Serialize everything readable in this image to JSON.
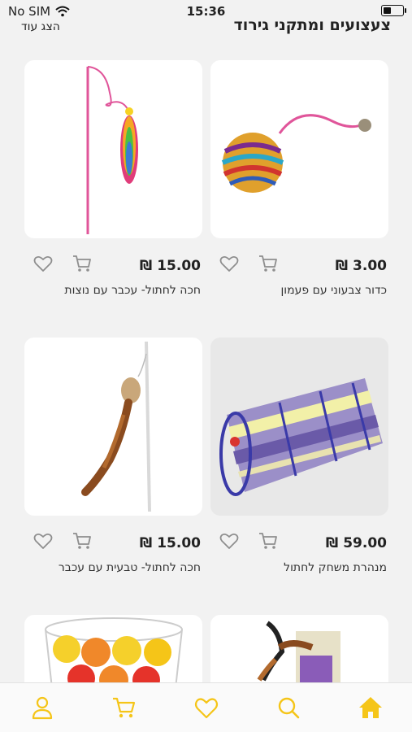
{
  "status": {
    "carrier": "No SIM",
    "time": "15:36"
  },
  "header": {
    "title": "צעצועים ומתקני גירוד",
    "show_more": "הצג עוד"
  },
  "products": [
    {
      "name": "כדור צבעוני עם פעמון",
      "price": "3.00 ₪",
      "image_icon": "ball-with-bell-toy"
    },
    {
      "name": "חכה לחתול- עכבר עם נוצות",
      "price": "15.00 ₪",
      "image_icon": "feather-wand-toy"
    },
    {
      "name": "מנהרת משחק לחתול",
      "price": "59.00 ₪",
      "image_icon": "cat-tunnel"
    },
    {
      "name": "חכה לחתול- טבעית עם עכבר",
      "price": "15.00 ₪",
      "image_icon": "natural-wand-toy"
    },
    {
      "name": "",
      "price": "",
      "image_icon": "feather-toy-package"
    },
    {
      "name": "",
      "price": "",
      "image_icon": "ball-jar"
    }
  ],
  "tab_bar": {
    "items": [
      "home",
      "search",
      "favorites",
      "cart",
      "profile"
    ]
  },
  "colors": {
    "accent": "#f5c518",
    "icon_gray": "#8e8e8e"
  }
}
